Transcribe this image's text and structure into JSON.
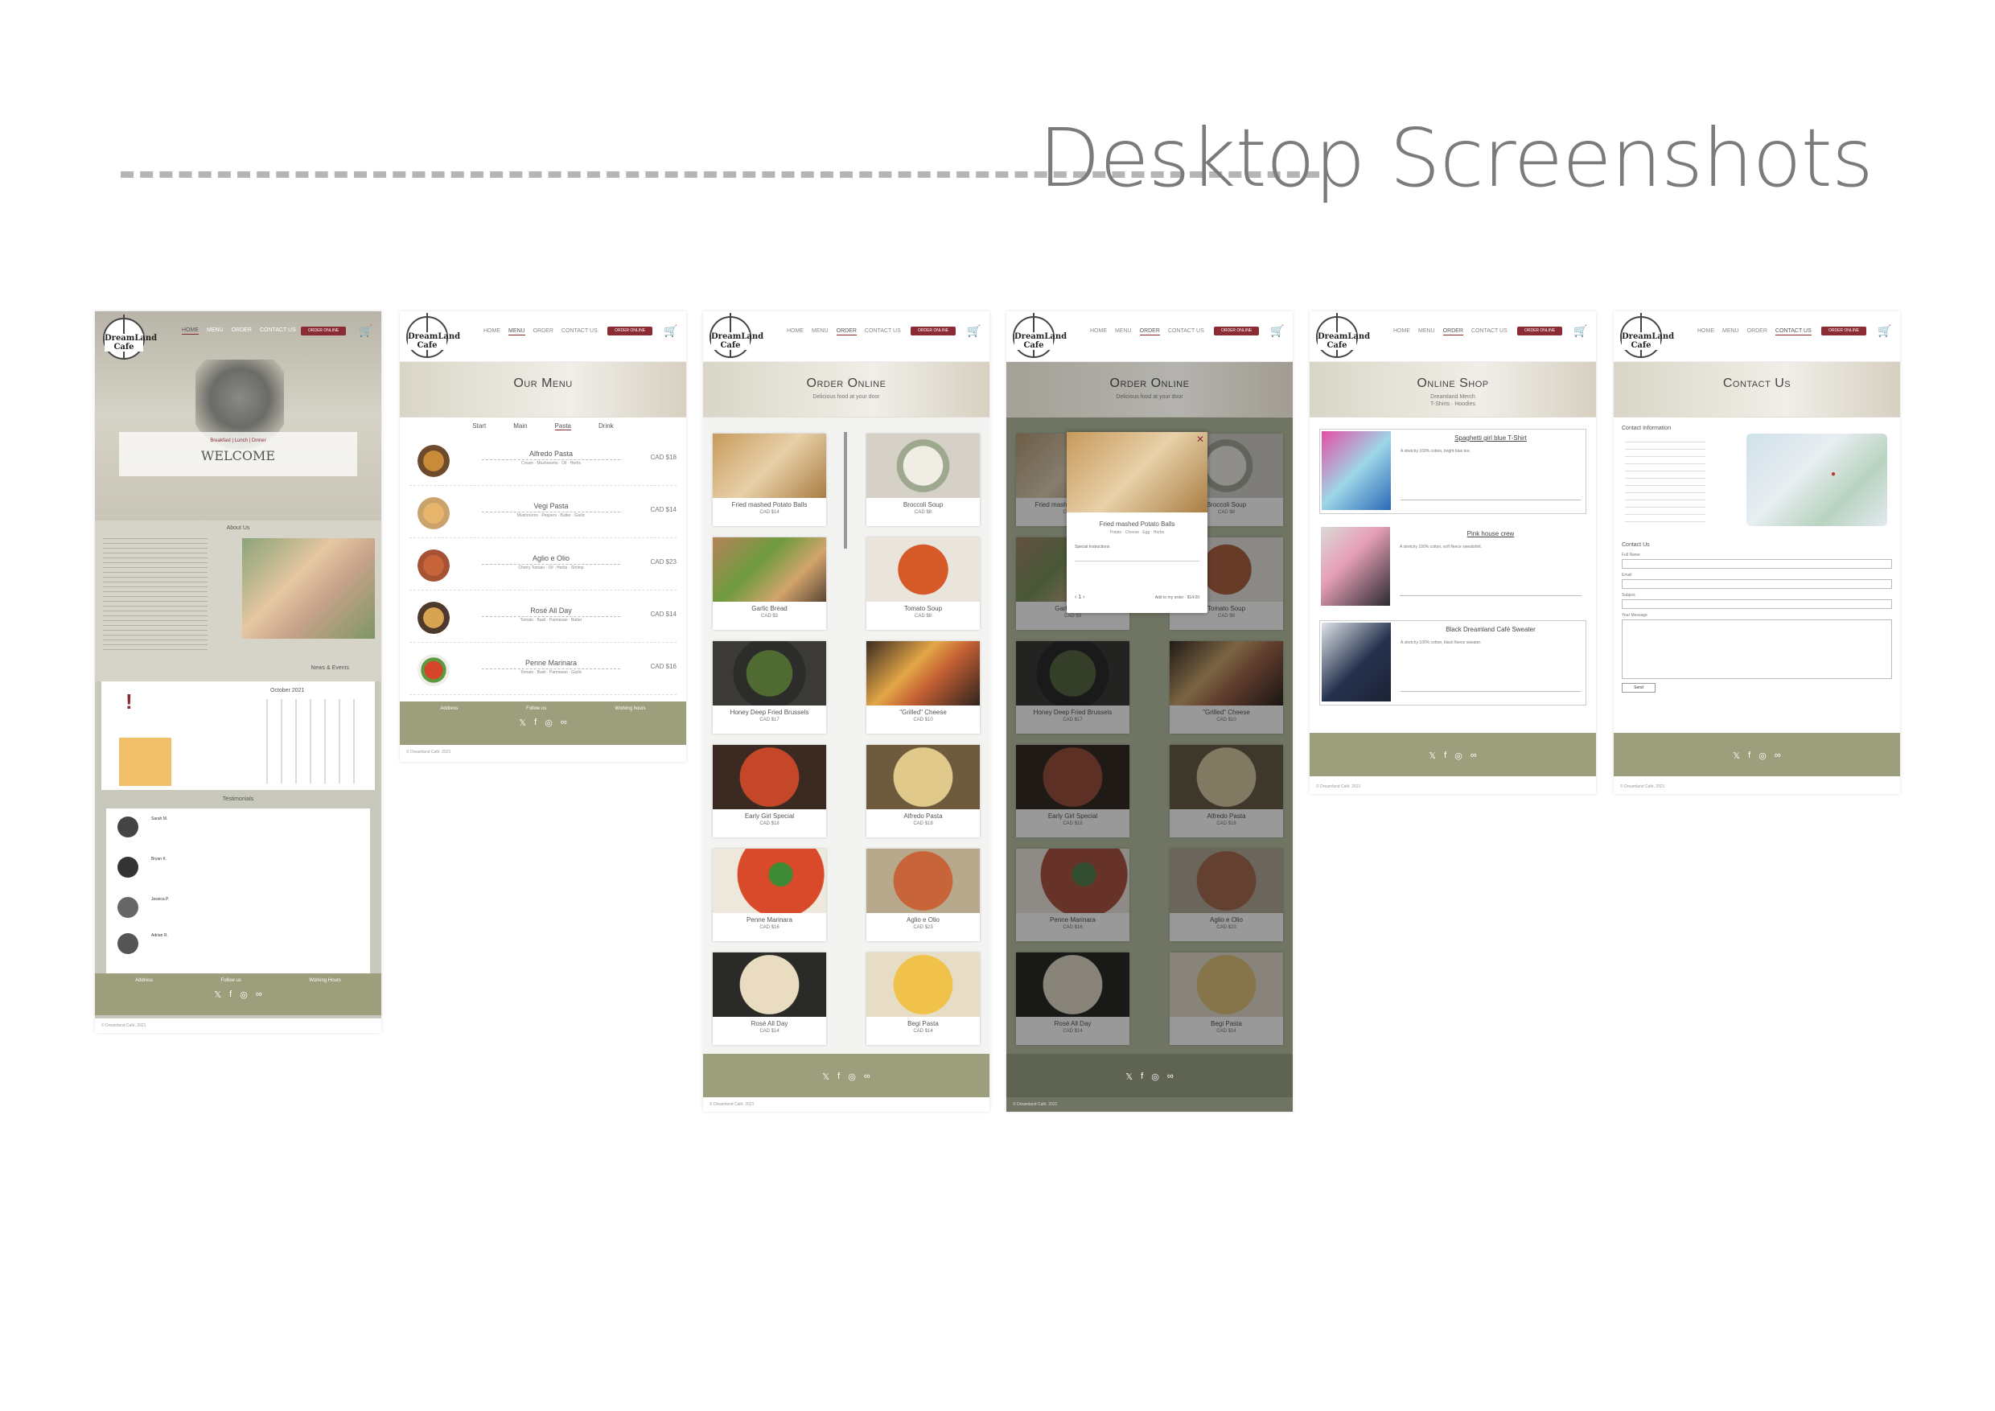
{
  "header": {
    "title": "Desktop Screenshots"
  },
  "common": {
    "logo": "DreamLand Cafe",
    "order_button": "ORDER ONLINE",
    "cart_icon": "cart-icon"
  },
  "home": {
    "welcome_sub": "Breakfast | Lunch | Dinner",
    "welcome": "WELCOME",
    "about_title": "About Us",
    "news_title": "News & Events",
    "calendar_month": "October 2021",
    "testimonials_title": "Testimonials",
    "reviewers": [
      "Sarah M.",
      "Bryan K.",
      "Jessica P.",
      "Adrian R."
    ],
    "footer_cols": [
      "Address",
      "Follow us",
      "Working Hours"
    ],
    "copyright": "© Dreamland Café, 2021"
  },
  "menu": {
    "title": "Our Menu",
    "nav": [
      "HOME",
      "MENU",
      "ORDER",
      "CONTACT US"
    ],
    "tabs": [
      "Start",
      "Main",
      "Pasta",
      "Drink"
    ],
    "active_tab": "Pasta",
    "items": [
      {
        "name": "Alfredo Pasta",
        "desc": "Cream · Mushrooms · Oil · Herbs",
        "price": "CAD $18"
      },
      {
        "name": "Vegi Pasta",
        "desc": "Mushrooms · Peppers · Butter · Garlic",
        "price": "CAD $14"
      },
      {
        "name": "Aglio e Olio",
        "desc": "Cherry Tomato · Oil · Herbs · Shrimp",
        "price": "CAD $23"
      },
      {
        "name": "Rosé All Day",
        "desc": "Tomato · Basil · Parmesan · Butter",
        "price": "CAD $14"
      },
      {
        "name": "Penne Marinara",
        "desc": "Tomato · Basil · Parmesan · Garlic",
        "price": "CAD $16"
      }
    ],
    "footer_cols": [
      "Address",
      "Follow us",
      "Working hours"
    ],
    "copyright": "© Dreamland Café, 2021"
  },
  "order": {
    "title": "Order Online",
    "subtitle": "Delicious food at your door",
    "items": [
      {
        "name": "Fried mashed Potato Balls",
        "price": "CAD $14"
      },
      {
        "name": "Broccoli Soup",
        "price": "CAD $8"
      },
      {
        "name": "Garlic Bread",
        "price": "CAD $3"
      },
      {
        "name": "Tomato Soup",
        "price": "CAD $8"
      },
      {
        "name": "Honey Deep Fried Brussels",
        "price": "CAD $17"
      },
      {
        "name": "\"Grilled\" Cheese",
        "price": "CAD $10"
      },
      {
        "name": "Early Girl Special",
        "price": "CAD $18"
      },
      {
        "name": "Alfredo Pasta",
        "price": "CAD $18"
      },
      {
        "name": "Penne Marinara",
        "price": "CAD $16"
      },
      {
        "name": "Aglio e Olio",
        "price": "CAD $23"
      },
      {
        "name": "Rosé All Day",
        "price": "CAD $14"
      },
      {
        "name": "Begi Pasta",
        "price": "CAD $14"
      }
    ],
    "copyright": "© Dreamland Café, 2021"
  },
  "modal": {
    "item": "Fried mashed Potato Balls",
    "line2": "Potato · Cheese · Egg · Herbs",
    "instr_label": "Special Instructions",
    "qty": "1",
    "add_label": "Add to my order · $14.00",
    "close_icon": "close-icon"
  },
  "shop": {
    "title": "Online Shop",
    "sub": [
      "Dreamland Merch",
      "T-Shirts · Hoodies"
    ],
    "products": [
      {
        "name": "Spaghetti girl blue T-Shirt",
        "desc": "A stretchy 100% cotton, bright blue tee."
      },
      {
        "name": "Pink house crew",
        "desc": "A stretchy 100% cotton, soft fleece sweatshirt."
      },
      {
        "name": "Black Dreamland Café Sweater",
        "desc": "A stretchy 100% cotton, black fleece sweater."
      }
    ],
    "copyright": "© Dreamland Café, 2021"
  },
  "contact": {
    "title": "Contact Us",
    "info_title": "Contact Information",
    "form_title": "Contact Us",
    "fields": [
      "Full Name",
      "Email",
      "Subject",
      "Your Message"
    ],
    "send": "Send",
    "copyright": "© Dreamland Café, 2021"
  }
}
